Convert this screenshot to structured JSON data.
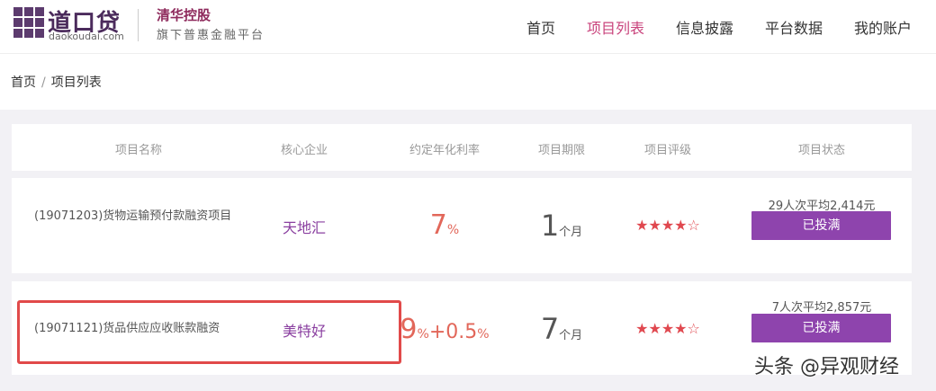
{
  "logo": {
    "name": "道口贷",
    "domain": "daokoudai.com",
    "partner": "清华控股",
    "slogan": "旗下普惠金融平台"
  },
  "nav": [
    {
      "label": "首页",
      "active": false
    },
    {
      "label": "项目列表",
      "active": true
    },
    {
      "label": "信息披露",
      "active": false
    },
    {
      "label": "平台数据",
      "active": false
    },
    {
      "label": "我的账户",
      "active": false
    }
  ],
  "breadcrumb": {
    "home": "首页",
    "separator": "/",
    "current": "项目列表"
  },
  "table": {
    "headers": [
      "项目名称",
      "核心企业",
      "约定年化利率",
      "项目期限",
      "项目评级",
      "项目状态"
    ],
    "rows": [
      {
        "name": "(19071203)货物运输预付款融资项目",
        "enterprise": "天地汇",
        "rate_value": "7",
        "rate_unit": "%",
        "rate_bonus": "",
        "rate_bonus_unit": "",
        "term_value": "1",
        "term_unit": "个月",
        "rating_filled": 4,
        "rating_total": 5,
        "stats": "29人次平均2,414元",
        "status": "已投满"
      },
      {
        "name": "(19071121)货品供应应收账款融资",
        "enterprise": "美特好",
        "rate_value": "9",
        "rate_unit": "%",
        "rate_bonus": "+0.5",
        "rate_bonus_unit": "%",
        "term_value": "7",
        "term_unit": "个月",
        "rating_filled": 4,
        "rating_total": 5,
        "stats": "7人次平均2,857元",
        "status": "已投满"
      }
    ]
  },
  "watermark": "头条 @异观财经",
  "colors": {
    "brand_purple": "#8e44ad",
    "active_nav": "#c9437c",
    "rate_red": "#e2675a",
    "highlight_red": "#e14a4a"
  }
}
